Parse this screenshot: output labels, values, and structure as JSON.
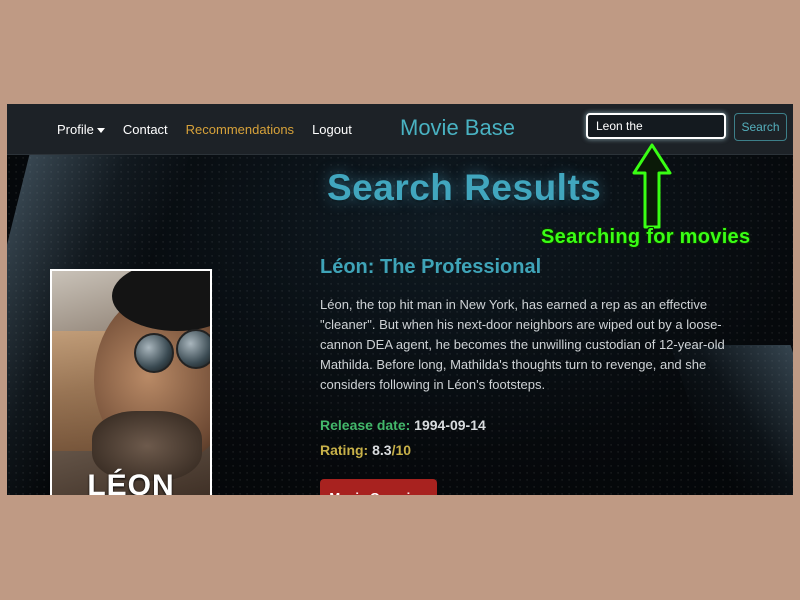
{
  "navbar": {
    "links": [
      {
        "label": "Profile"
      },
      {
        "label": "Contact"
      },
      {
        "label": "Recommendations"
      },
      {
        "label": "Logout"
      }
    ],
    "brand": "Movie Base",
    "search": {
      "value": "Leon the",
      "button_label": "Search"
    }
  },
  "main": {
    "heading": "Search Results",
    "movie": {
      "title": "Léon: The Professional",
      "overview": "Léon, the top hit man in New York, has earned a rep as an effective \"cleaner\". But when his next-door neighbors are wiped out by a loose-cannon DEA agent, he becomes the unwilling custodian of 12-year-old Mathilda. Before long, Mathilda's thoughts turn to revenge, and she considers following in Léon's footsteps.",
      "release_label": "Release date:",
      "release_date": "1994-09-14",
      "rating_label": "Rating:",
      "rating_value": "8.3",
      "rating_max": "/10",
      "poster_title": "LÉON",
      "overview_button": "Movie Overview"
    }
  },
  "annotation": {
    "text": "Searching for movies",
    "color": "#39ff14"
  },
  "colors": {
    "page_background": "#bf9a84",
    "navbar_background": "#1d2227",
    "accent_teal": "#41a6be",
    "active_link": "#d7a23a",
    "release_label": "#43b86b",
    "rating_label": "#c8b149",
    "button_red": "#a8221f"
  }
}
